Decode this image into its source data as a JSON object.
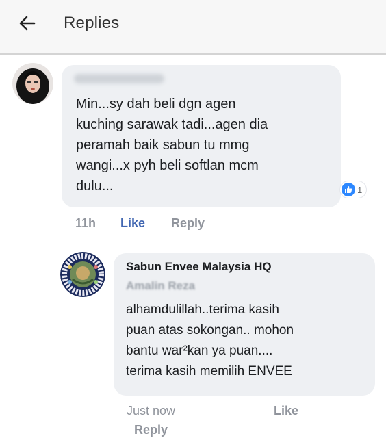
{
  "header": {
    "title": "Replies",
    "back_icon": "arrow-left-icon"
  },
  "comment": {
    "lines": [
      "Min...sy dah beli dgn agen",
      "kuching sarawak tadi...agen dia",
      "peramah baik sabun tu mmg",
      "wangi...x pyh beli softlan mcm",
      "dulu..."
    ],
    "reaction_icon": "thumbs-up-icon",
    "reaction_count": "1",
    "time": "11h",
    "like_label": "Like",
    "reply_label": "Reply"
  },
  "reply": {
    "author": "Sabun Envee Malaysia HQ",
    "tagged_name": "Amalin Reza",
    "lines": [
      "alhamdulillah..terima kasih",
      "puan atas sokongan..  mohon",
      "bantu war²kan ya puan....",
      "terima kasih memilih ENVEE"
    ],
    "time": "Just now",
    "like_label": "Like",
    "reply_label": "Reply"
  },
  "colors": {
    "link_blue": "#4267b2",
    "bubble_bg": "#eef0f3",
    "meta_gray": "#90949c",
    "like_badge": "#2d88ff"
  }
}
